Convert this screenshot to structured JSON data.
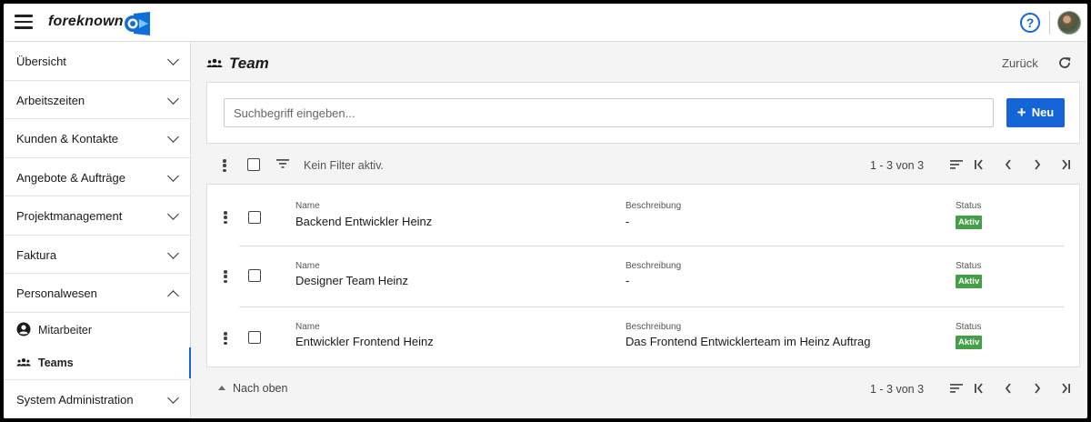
{
  "app": {
    "name": "foreknown",
    "help_symbol": "?"
  },
  "sidebar": {
    "items": [
      {
        "label": "Übersicht"
      },
      {
        "label": "Arbeitszeiten"
      },
      {
        "label": "Kunden & Kontakte"
      },
      {
        "label": "Angebote & Aufträge"
      },
      {
        "label": "Projektmanagement"
      },
      {
        "label": "Faktura"
      },
      {
        "label": "Personalwesen"
      }
    ],
    "subitems": [
      {
        "label": "Mitarbeiter",
        "icon": "account-circle-icon"
      },
      {
        "label": "Teams",
        "icon": "groups-icon"
      }
    ],
    "last_item": {
      "label": "System Administration"
    }
  },
  "page": {
    "title": "Team",
    "back_label": "Zurück",
    "search_placeholder": "Suchbegriff eingeben...",
    "new_button_label": "Neu",
    "filter_text": "Kein Filter aktiv.",
    "pager_text": "1 - 3 von 3",
    "scroll_top_label": "Nach oben"
  },
  "columns": {
    "name": "Name",
    "description": "Beschreibung",
    "status": "Status"
  },
  "rows": [
    {
      "name": "Backend Entwickler Heinz",
      "description": "-",
      "status": "Aktiv"
    },
    {
      "name": "Designer Team Heinz",
      "description": "-",
      "status": "Aktiv"
    },
    {
      "name": "Entwickler Frontend Heinz",
      "description": "Das Frontend Entwicklerteam im Heinz Auftrag",
      "status": "Aktiv"
    }
  ],
  "colors": {
    "accent": "#1565d8",
    "status_active": "#43a047"
  }
}
